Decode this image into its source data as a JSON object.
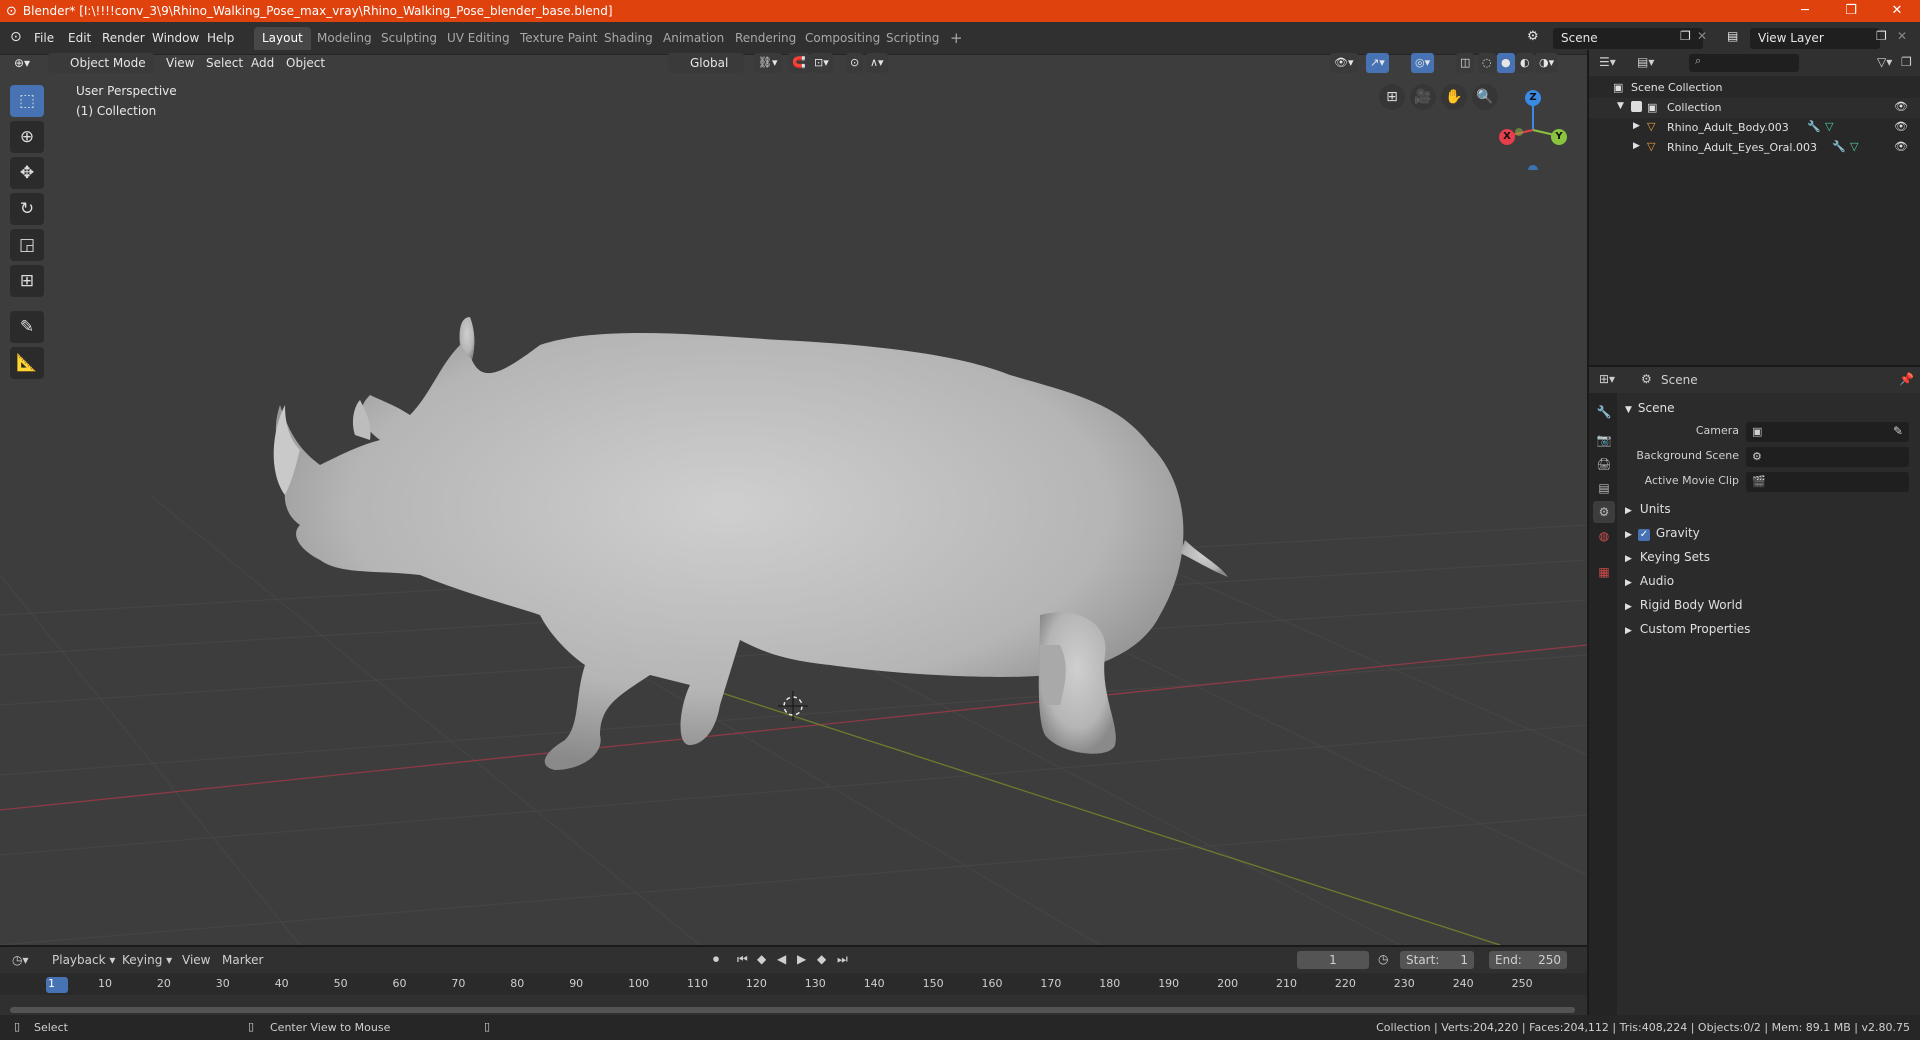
{
  "window": {
    "title": "Blender* [I:\\!!!!conv_3\\9\\Rhino_Walking_Pose_max_vray\\Rhino_Walking_Pose_blender_base.blend]",
    "min": "─",
    "max": "❐",
    "close": "✕"
  },
  "menu": [
    "File",
    "Edit",
    "Render",
    "Window",
    "Help"
  ],
  "workspaces": [
    "Layout",
    "Modeling",
    "Sculpting",
    "UV Editing",
    "Texture Paint",
    "Shading",
    "Animation",
    "Rendering",
    "Compositing",
    "Scripting"
  ],
  "add_workspace": "+",
  "scene_field": "Scene",
  "view_layer_field": "View Layer",
  "viewport_header": {
    "mode": "Object Mode",
    "view": "View",
    "select": "Select",
    "add": "Add",
    "object": "Object",
    "orientation": "Global"
  },
  "viewport": {
    "perspective": "User Perspective",
    "collection": "(1) Collection",
    "background": "#3d3d3d"
  },
  "gizmo": {
    "x": "X",
    "y": "Y",
    "z": "Z",
    "x_color": "#e53e4c",
    "y_color": "#8ac43f",
    "z_color": "#3a8ae3"
  },
  "outliner": {
    "root": "Scene Collection",
    "collection": "Collection",
    "items": [
      "Rhino_Adult_Body.003",
      "Rhino_Adult_Eyes_Oral.003"
    ]
  },
  "properties": {
    "context": "Scene",
    "panel": "Scene",
    "camera_label": "Camera",
    "background_scene_label": "Background Scene",
    "active_movie_clip_label": "Active Movie Clip",
    "sections": [
      "Units",
      "Gravity",
      "Keying Sets",
      "Audio",
      "Rigid Body World",
      "Custom Properties"
    ],
    "gravity_checked": true
  },
  "timeline": {
    "playback": "Playback",
    "keying": "Keying",
    "view": "View",
    "marker": "Marker",
    "current_frame": "1",
    "start_label": "Start:",
    "start": "1",
    "end_label": "End:",
    "end": "250",
    "ticks": [
      "1",
      "10",
      "20",
      "30",
      "40",
      "50",
      "60",
      "70",
      "80",
      "90",
      "100",
      "110",
      "120",
      "130",
      "140",
      "150",
      "160",
      "170",
      "180",
      "190",
      "200",
      "210",
      "220",
      "230",
      "240",
      "250"
    ]
  },
  "status": {
    "select": "Select",
    "center_view": "Center View to Mouse",
    "stats": "Collection | Verts:204,220 | Faces:204,112 | Tris:408,224 | Objects:0/2 | Mem: 89.1 MB | v2.80.75"
  }
}
